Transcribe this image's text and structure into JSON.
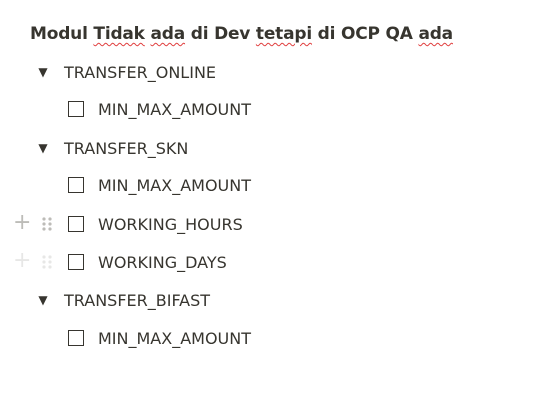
{
  "heading": {
    "parts": [
      {
        "text": "Modul ",
        "squiggle": false
      },
      {
        "text": "Tidak",
        "squiggle": true
      },
      {
        "text": " ",
        "squiggle": false
      },
      {
        "text": "ada",
        "squiggle": true
      },
      {
        "text": " di Dev ",
        "squiggle": false
      },
      {
        "text": "tetapi",
        "squiggle": true
      },
      {
        "text": " di OCP QA ",
        "squiggle": false
      },
      {
        "text": "ada",
        "squiggle": true
      }
    ]
  },
  "toggle_icon": "triangle-down-icon",
  "add_icon": "plus-icon",
  "drag_icon": "drag-handle-icon",
  "sections": [
    {
      "label": "TRANSFER_ONLINE",
      "items": [
        {
          "label": "MIN_MAX_AMOUNT",
          "checked": false
        }
      ]
    },
    {
      "label": "TRANSFER_SKN",
      "items": [
        {
          "label": "MIN_MAX_AMOUNT",
          "checked": false
        },
        {
          "label": "WORKING_HOURS",
          "checked": false
        },
        {
          "label": "WORKING_DAYS",
          "checked": false
        }
      ]
    },
    {
      "label": "TRANSFER_BIFAST",
      "items": [
        {
          "label": "MIN_MAX_AMOUNT",
          "checked": false
        }
      ]
    }
  ]
}
